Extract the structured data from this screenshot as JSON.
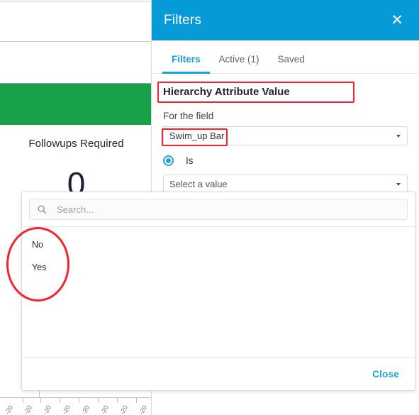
{
  "dashboard": {
    "kpi_title": "Followups Required",
    "kpi_value": "0",
    "green_band_color": "#17a24a",
    "axis_tick_labels": [
      "-20",
      "-20",
      "-20",
      "-20",
      "-20",
      "-20",
      "-20",
      "-20"
    ]
  },
  "filters_panel": {
    "title": "Filters",
    "close_icon": "close-icon",
    "tabs": [
      {
        "label": "Filters",
        "active": true
      },
      {
        "label": "Active (1)",
        "active": false
      },
      {
        "label": "Saved",
        "active": false
      }
    ],
    "section_heading": "Hierarchy Attribute Value",
    "field_label": "For the field",
    "field_select": {
      "value": "Swim_up Bar",
      "caret_icon": "chevron-down-icon"
    },
    "operator": {
      "label": "Is",
      "selected": true
    },
    "value_select": {
      "placeholder": "Select a value",
      "caret_icon": "chevron-down-icon"
    },
    "accent_color": "#069bd7"
  },
  "value_dropdown": {
    "search": {
      "placeholder": "Search...",
      "value": "",
      "icon": "search-icon"
    },
    "options": [
      {
        "label": "No"
      },
      {
        "label": "Yes"
      }
    ],
    "close_label": "Close"
  },
  "annotations": {
    "color": "#f4232f",
    "heading_box": "Hierarchy Attribute Value",
    "field_box": "Swim_up Bar",
    "options_ellipse": "No / Yes options"
  }
}
